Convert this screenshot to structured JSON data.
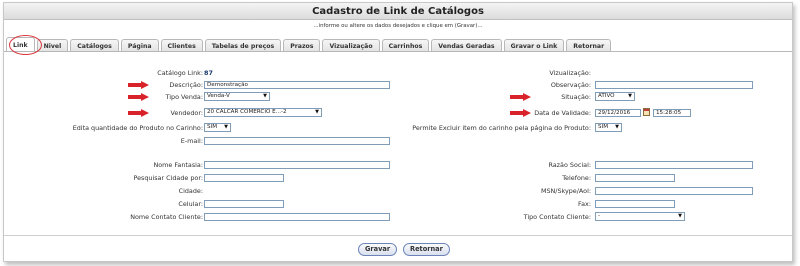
{
  "header": {
    "title": "Cadastro de Link de Catálogos",
    "subtitle": "...informe ou altere os dados desejados e clique em (Gravar)..."
  },
  "tabs": [
    {
      "label": "Link",
      "active": true
    },
    {
      "label": "Nivel"
    },
    {
      "label": "Catálogos"
    },
    {
      "label": "Página"
    },
    {
      "label": "Clientes"
    },
    {
      "label": "Tabelas de preços"
    },
    {
      "label": "Prazos"
    },
    {
      "label": "Vizualização"
    },
    {
      "label": "Carrinhos"
    },
    {
      "label": "Vendas Geradas"
    },
    {
      "label": "Gravar o Link"
    },
    {
      "label": "Retornar"
    }
  ],
  "form": {
    "catalogo_link": {
      "label": "Catálogo Link:",
      "value": "87"
    },
    "descricao": {
      "label": "Descrição:",
      "value": "Demonstração"
    },
    "tipo_venda": {
      "label": "Tipo Venda:",
      "value": "Venda-V"
    },
    "vendedor": {
      "label": "Vendedor:",
      "value": "20 CALCAR COMERCIO E...-2"
    },
    "edita_quantidade": {
      "label": "Edita quantidade do Produto no Carinho:",
      "value": "SIM"
    },
    "email": {
      "label": "E-mail:",
      "value": ""
    },
    "visualizacao": {
      "label": "Vizualização:",
      "value": ""
    },
    "observacao": {
      "label": "Observação:",
      "value": ""
    },
    "situacao": {
      "label": "Situação:",
      "value": "ATIVO"
    },
    "data_validade": {
      "label": "Data de Validade:",
      "date": "29/12/2016",
      "time": "15:28:05"
    },
    "permite_excluir": {
      "label": "Permite Excluir item do carinho pela página do Produto:",
      "value": "SIM"
    },
    "nome_fantasia": {
      "label": "Nome Fantasia:",
      "value": ""
    },
    "pesquisar_cidade": {
      "label": "Pesquisar Cidade por:",
      "value": ""
    },
    "cidade": {
      "label": "Cidade:",
      "value": ""
    },
    "celular": {
      "label": "Celular:",
      "value": ""
    },
    "nome_contato": {
      "label": "Nome Contato Cliente:",
      "value": ""
    },
    "razao_social": {
      "label": "Razão Social:",
      "value": ""
    },
    "telefone": {
      "label": "Telefone:",
      "value": ""
    },
    "msn_skype": {
      "label": "MSN/Skype/Aol:",
      "value": ""
    },
    "fax": {
      "label": "Fax:",
      "value": ""
    },
    "tipo_contato": {
      "label": "Tipo Contato Cliente:",
      "value": "-"
    }
  },
  "buttons": {
    "gravar": "Gravar",
    "retornar": "Retornar"
  },
  "colors": {
    "annotation_red": "#d9232a",
    "input_border": "#7f9db9",
    "link_value": "#1a3a6a"
  }
}
